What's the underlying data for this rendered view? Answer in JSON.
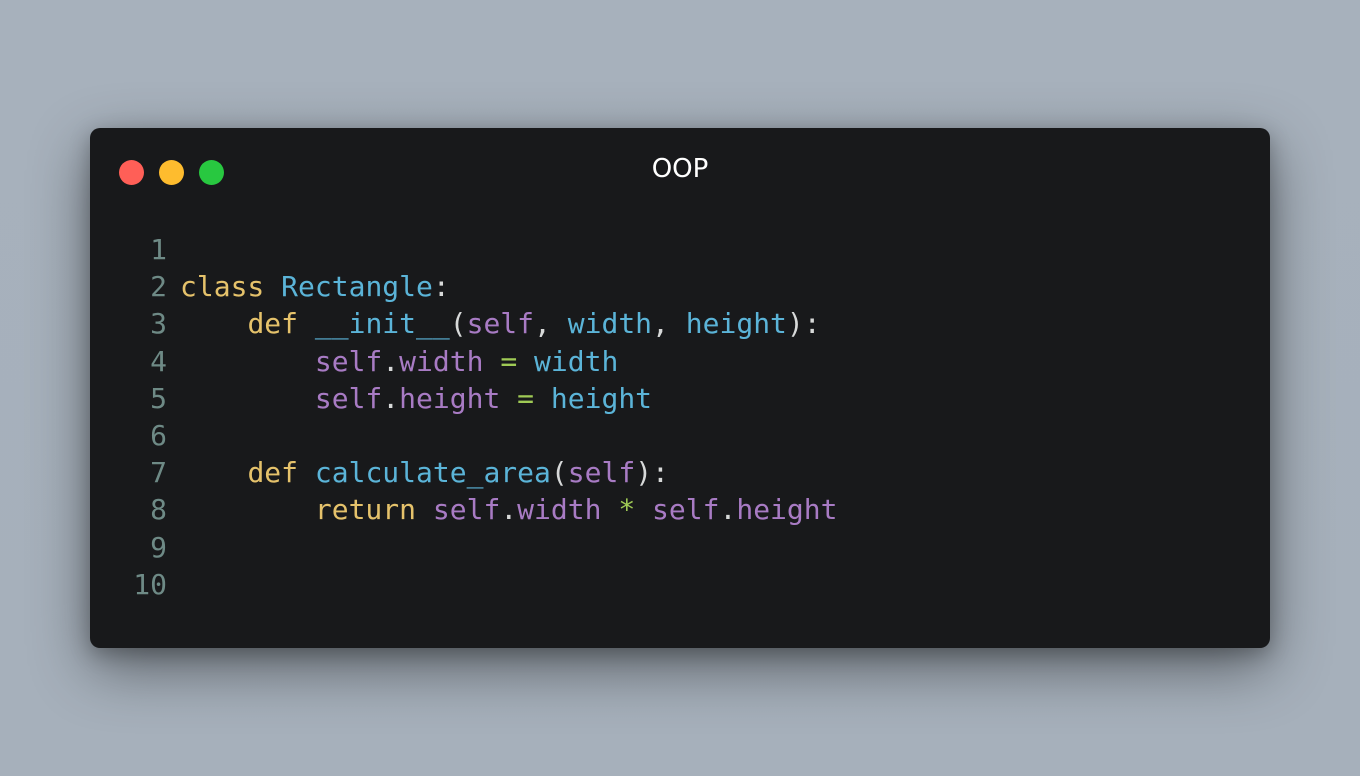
{
  "window": {
    "title": "OOP",
    "controls": [
      "close",
      "minimize",
      "maximize"
    ]
  },
  "colors": {
    "keyword": "#e5c26b",
    "name": "#5bb4d8",
    "self": "#a87bc4",
    "operator": "#9fca55",
    "line_number": "#6e8a86",
    "background": "#18191b"
  },
  "code": {
    "language": "python",
    "lines": [
      {
        "n": "1",
        "tokens": []
      },
      {
        "n": "2",
        "tokens": [
          [
            "kw",
            "class"
          ],
          [
            "pun",
            " "
          ],
          [
            "fn",
            "Rectangle"
          ],
          [
            "pun",
            ":"
          ]
        ]
      },
      {
        "n": "3",
        "tokens": [
          [
            "pun",
            "    "
          ],
          [
            "kw",
            "def"
          ],
          [
            "pun",
            " "
          ],
          [
            "fn",
            "__init__"
          ],
          [
            "pun",
            "("
          ],
          [
            "self",
            "self"
          ],
          [
            "pun",
            ", "
          ],
          [
            "fn",
            "width"
          ],
          [
            "pun",
            ", "
          ],
          [
            "fn",
            "height"
          ],
          [
            "pun",
            "):"
          ]
        ]
      },
      {
        "n": "4",
        "tokens": [
          [
            "pun",
            "        "
          ],
          [
            "self",
            "self"
          ],
          [
            "pun",
            "."
          ],
          [
            "self",
            "width"
          ],
          [
            "pun",
            " "
          ],
          [
            "op",
            "="
          ],
          [
            "pun",
            " "
          ],
          [
            "fn",
            "width"
          ]
        ]
      },
      {
        "n": "5",
        "tokens": [
          [
            "pun",
            "        "
          ],
          [
            "self",
            "self"
          ],
          [
            "pun",
            "."
          ],
          [
            "self",
            "height"
          ],
          [
            "pun",
            " "
          ],
          [
            "op",
            "="
          ],
          [
            "pun",
            " "
          ],
          [
            "fn",
            "height"
          ]
        ]
      },
      {
        "n": "6",
        "tokens": []
      },
      {
        "n": "7",
        "tokens": [
          [
            "pun",
            "    "
          ],
          [
            "kw",
            "def"
          ],
          [
            "pun",
            " "
          ],
          [
            "fn",
            "calculate_area"
          ],
          [
            "pun",
            "("
          ],
          [
            "self",
            "self"
          ],
          [
            "pun",
            "):"
          ]
        ]
      },
      {
        "n": "8",
        "tokens": [
          [
            "pun",
            "        "
          ],
          [
            "kw",
            "return"
          ],
          [
            "pun",
            " "
          ],
          [
            "self",
            "self"
          ],
          [
            "pun",
            "."
          ],
          [
            "self",
            "width"
          ],
          [
            "pun",
            " "
          ],
          [
            "op",
            "*"
          ],
          [
            "pun",
            " "
          ],
          [
            "self",
            "self"
          ],
          [
            "pun",
            "."
          ],
          [
            "self",
            "height"
          ]
        ]
      },
      {
        "n": "9",
        "tokens": []
      },
      {
        "n": "10",
        "tokens": []
      }
    ]
  }
}
